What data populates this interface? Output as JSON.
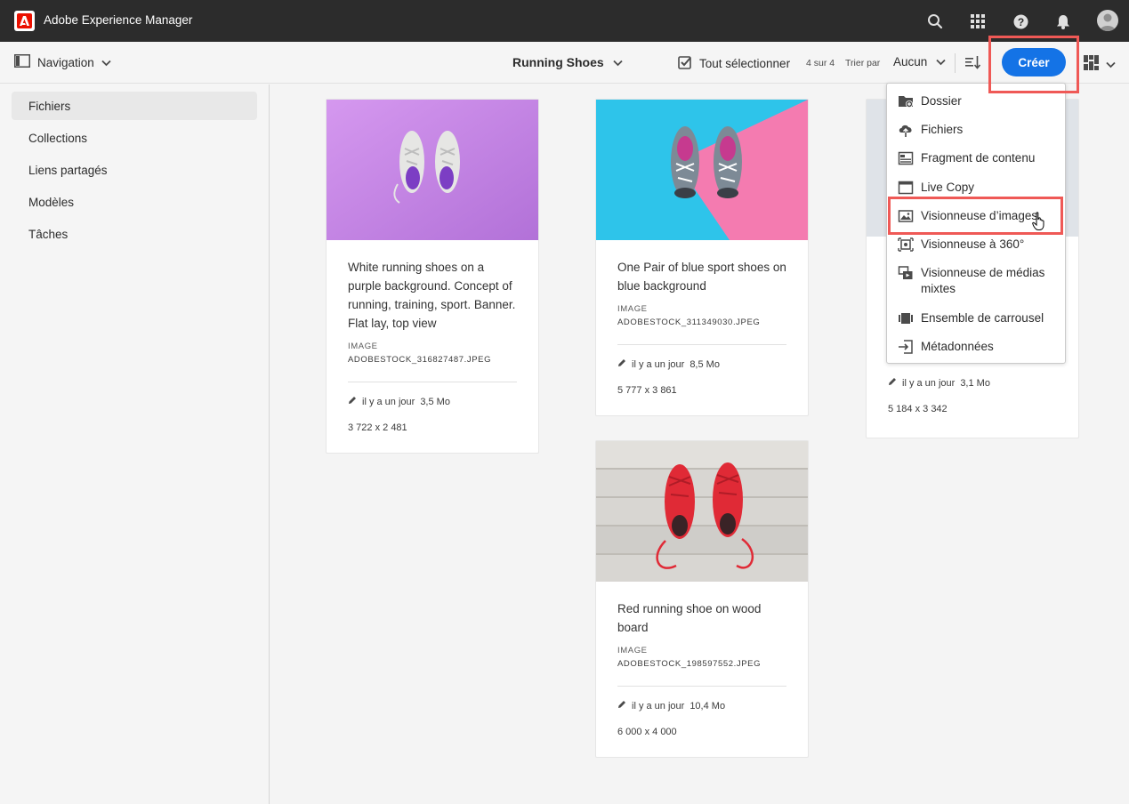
{
  "app": {
    "title": "Adobe Experience Manager",
    "brand_color": "#eb1000"
  },
  "topbar_icons": [
    "search-icon",
    "apps-grid-icon",
    "help-icon",
    "bell-icon",
    "user-avatar"
  ],
  "actionbar": {
    "nav_label": "Navigation",
    "folder_title": "Running Shoes",
    "select_all": "Tout sélectionner",
    "count": "4 sur 4",
    "sort_by": "Trier par",
    "sort_value": "Aucun",
    "create_label": "Créer",
    "accent": "#1473e6"
  },
  "sidebar": {
    "items": [
      {
        "label": "Fichiers",
        "active": true
      },
      {
        "label": "Collections"
      },
      {
        "label": "Liens partagés"
      },
      {
        "label": "Modèles"
      },
      {
        "label": "Tâches"
      }
    ]
  },
  "cards": [
    {
      "title": "White running shoes on a purple background. Concept of running, training, sport. Banner. Flat lay, top view",
      "type": "IMAGE",
      "file": "ADOBESTOCK_316827487.JPEG",
      "modified": "il y a un jour",
      "size": "3,5 Mo",
      "dims": "3 722 x 2 481"
    },
    {
      "title": "One Pair of blue sport shoes on blue background",
      "type": "IMAGE",
      "file": "ADOBESTOCK_311349030.JPEG",
      "modified": "il y a un jour",
      "size": "8,5 Mo",
      "dims": "5 777 x 3 861"
    },
    {
      "title": "Red running shoe on wood board",
      "type": "IMAGE",
      "file": "ADOBESTOCK_198597552.JPEG",
      "modified": "il y a un jour",
      "size": "10,4 Mo",
      "dims": "6 000 x 4 000"
    },
    {
      "modified": "il y a un jour",
      "size": "3,1 Mo",
      "dims": "5 184 x 3 342"
    }
  ],
  "create_menu": {
    "items": [
      {
        "label": "Dossier",
        "icon": "folder-add-icon"
      },
      {
        "label": "Fichiers",
        "icon": "cloud-upload-icon"
      },
      {
        "label": "Fragment de contenu",
        "icon": "content-fragment-icon"
      },
      {
        "label": "Live Copy",
        "icon": "live-copy-icon"
      },
      {
        "label": "Visionneuse d’images",
        "icon": "image-viewer-icon",
        "highlighted": true
      },
      {
        "label": "Visionneuse à 360°",
        "icon": "spin-360-icon"
      },
      {
        "label": "Visionneuse de médias mixtes",
        "icon": "mixed-media-icon"
      },
      {
        "label": "Ensemble de carrousel",
        "icon": "carousel-icon"
      },
      {
        "label": "Métadonnées",
        "icon": "metadata-icon"
      }
    ]
  }
}
